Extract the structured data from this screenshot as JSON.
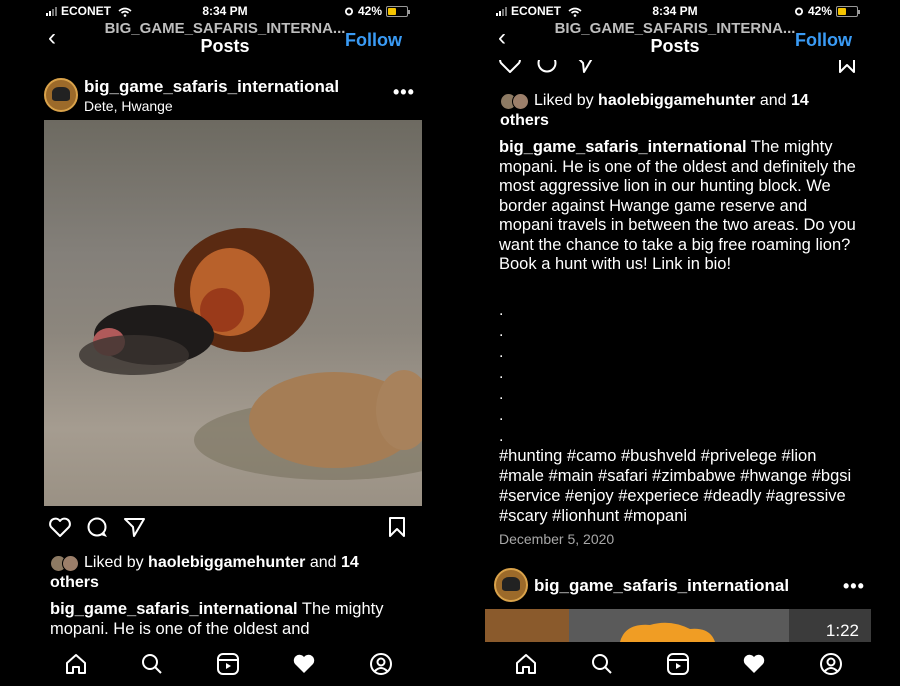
{
  "status_bar": {
    "carrier": "ECONET",
    "time": "8:34 PM",
    "battery": "42%",
    "battery_level": 0.42
  },
  "nav": {
    "handle": "BIG_GAME_SAFARIS_INTERNA...",
    "title": "Posts",
    "follow": "Follow"
  },
  "post": {
    "username": "big_game_safaris_international",
    "location": "Dete, Hwange",
    "liked_prefix": "Liked by ",
    "liked_user": "haolebiggamehunter",
    "liked_suffix": " and ",
    "liked_others": "14 others",
    "caption_user": "big_game_safaris_international",
    "caption_preview": " The mighty mopani. He is one of the oldest and",
    "caption_full": " The mighty mopani. He is one of the oldest and definitely the most aggressive lion in our hunting block. We border against Hwange game reserve and mopani travels in between the two areas. Do you want the chance to take a big free roaming lion? Book a hunt with us! Link in bio!",
    "dots": ".\n.\n.\n.\n.\n.\n.",
    "hashtags": "#hunting #camo #bushveld #privelege #lion #male #main #safari #zimbabwe #hwange #bgsi #service #enjoy #experiece #deadly #agressive #scary #lionhunt #mopani",
    "date": "December 5, 2020"
  },
  "next_post": {
    "username": "big_game_safaris_international",
    "duration": "1:22"
  },
  "icons": {
    "actions": [
      "heart-icon",
      "comment-icon",
      "share-icon",
      "bookmark-icon"
    ],
    "tabbar": [
      "home-icon",
      "search-icon",
      "reels-icon",
      "activity-heart-icon",
      "profile-icon"
    ]
  },
  "colors": {
    "follow": "#3a9bf5",
    "background": "#000000",
    "battery": "#f5c400"
  }
}
